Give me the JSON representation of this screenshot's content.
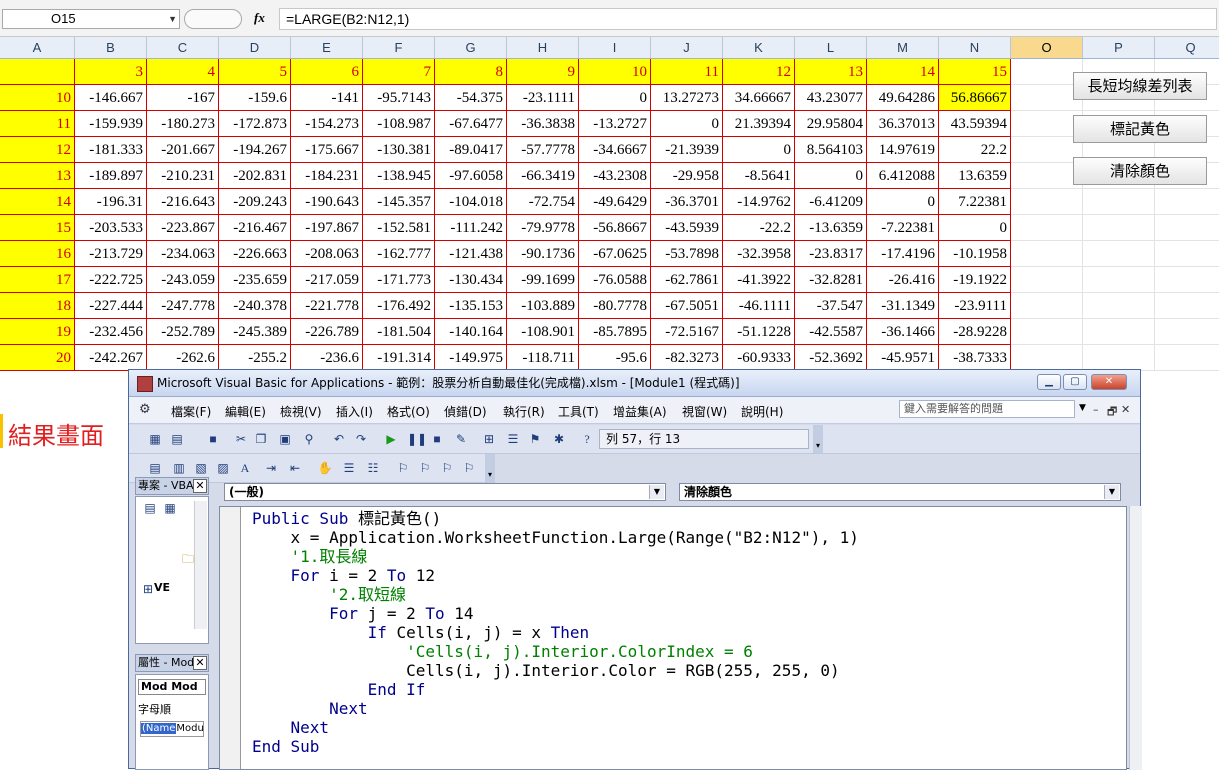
{
  "formula_bar": {
    "name_box": "O15",
    "fx_label": "fx",
    "formula": "=LARGE(B2:N12,1)"
  },
  "columns": [
    "A",
    "B",
    "C",
    "D",
    "E",
    "F",
    "G",
    "H",
    "I",
    "J",
    "K",
    "L",
    "M",
    "N",
    "O",
    "P",
    "Q"
  ],
  "selected_column": "O",
  "header_row": [
    "3",
    "4",
    "5",
    "6",
    "7",
    "8",
    "9",
    "10",
    "11",
    "12",
    "13",
    "14",
    "15"
  ],
  "rows": [
    {
      "label": "10",
      "values": [
        "-146.667",
        "-167",
        "-159.6",
        "-141",
        "-95.7143",
        "-54.375",
        "-23.1111",
        "0",
        "13.27273",
        "34.66667",
        "43.23077",
        "49.64286",
        "56.86667"
      ]
    },
    {
      "label": "11",
      "values": [
        "-159.939",
        "-180.273",
        "-172.873",
        "-154.273",
        "-108.987",
        "-67.6477",
        "-36.3838",
        "-13.2727",
        "0",
        "21.39394",
        "29.95804",
        "36.37013",
        "43.59394"
      ]
    },
    {
      "label": "12",
      "values": [
        "-181.333",
        "-201.667",
        "-194.267",
        "-175.667",
        "-130.381",
        "-89.0417",
        "-57.7778",
        "-34.6667",
        "-21.3939",
        "0",
        "8.564103",
        "14.97619",
        "22.2"
      ]
    },
    {
      "label": "13",
      "values": [
        "-189.897",
        "-210.231",
        "-202.831",
        "-184.231",
        "-138.945",
        "-97.6058",
        "-66.3419",
        "-43.2308",
        "-29.958",
        "-8.5641",
        "0",
        "6.412088",
        "13.6359"
      ]
    },
    {
      "label": "14",
      "values": [
        "-196.31",
        "-216.643",
        "-209.243",
        "-190.643",
        "-145.357",
        "-104.018",
        "-72.754",
        "-49.6429",
        "-36.3701",
        "-14.9762",
        "-6.41209",
        "0",
        "7.22381"
      ]
    },
    {
      "label": "15",
      "values": [
        "-203.533",
        "-223.867",
        "-216.467",
        "-197.867",
        "-152.581",
        "-111.242",
        "-79.9778",
        "-56.8667",
        "-43.5939",
        "-22.2",
        "-13.6359",
        "-7.22381",
        "0"
      ]
    },
    {
      "label": "16",
      "values": [
        "-213.729",
        "-234.063",
        "-226.663",
        "-208.063",
        "-162.777",
        "-121.438",
        "-90.1736",
        "-67.0625",
        "-53.7898",
        "-32.3958",
        "-23.8317",
        "-17.4196",
        "-10.1958"
      ]
    },
    {
      "label": "17",
      "values": [
        "-222.725",
        "-243.059",
        "-235.659",
        "-217.059",
        "-171.773",
        "-130.434",
        "-99.1699",
        "-76.0588",
        "-62.7861",
        "-41.3922",
        "-32.8281",
        "-26.416",
        "-19.1922"
      ]
    },
    {
      "label": "18",
      "values": [
        "-227.444",
        "-247.778",
        "-240.378",
        "-221.778",
        "-176.492",
        "-135.153",
        "-103.889",
        "-80.7778",
        "-67.5051",
        "-46.1111",
        "-37.547",
        "-31.1349",
        "-23.9111"
      ]
    },
    {
      "label": "19",
      "values": [
        "-232.456",
        "-252.789",
        "-245.389",
        "-226.789",
        "-181.504",
        "-140.164",
        "-108.901",
        "-85.7895",
        "-72.5167",
        "-51.1228",
        "-42.5587",
        "-36.1466",
        "-28.9228"
      ]
    },
    {
      "label": "20",
      "values": [
        "-242.267",
        "-262.6",
        "-255.2",
        "-236.6",
        "-191.314",
        "-149.975",
        "-118.711",
        "-95.6",
        "-82.3273",
        "-60.9333",
        "-52.3692",
        "-45.9571",
        "-38.7333"
      ]
    }
  ],
  "buttons": {
    "list": "長短均線差列表",
    "mark_yellow": "標記黃色",
    "clear_color": "清除顏色"
  },
  "result_label": "結果畫面",
  "vba": {
    "title": "Microsoft Visual Basic for Applications - 範例：股票分析自動最佳化(完成檔).xlsm - [Module1 (程式碼)]",
    "menus": [
      "檔案(F)",
      "編輯(E)",
      "檢視(V)",
      "插入(I)",
      "格式(O)",
      "偵錯(D)",
      "執行(R)",
      "工具(T)",
      "增益集(A)",
      "視窗(W)",
      "說明(H)"
    ],
    "help_placeholder": "鍵入需要解答的問題",
    "cursor_pos": "列 57，行 13",
    "project_title": "專案 - VBAI",
    "project_node": "VE",
    "props_title": "屬性 - Mod",
    "props_combo": "Mod Mod",
    "props_tab": "字母順",
    "props_name": "(Name",
    "props_value": "Modu",
    "combo_general": "(一般)",
    "combo_proc": "清除顏色",
    "code": [
      {
        "indent": "",
        "parts": [
          {
            "t": "Public Sub ",
            "c": "kw"
          },
          {
            "t": "標記黃色()",
            "c": ""
          }
        ]
      },
      {
        "indent": "    ",
        "parts": [
          {
            "t": "x = Application.WorksheetFunction.Large(Range(\"B2:N12\"), 1)",
            "c": ""
          }
        ]
      },
      {
        "indent": "    ",
        "parts": [
          {
            "t": "'1.取長線",
            "c": "cm"
          }
        ]
      },
      {
        "indent": "    ",
        "parts": [
          {
            "t": "For ",
            "c": "kw"
          },
          {
            "t": "i = 2 ",
            "c": ""
          },
          {
            "t": "To ",
            "c": "kw"
          },
          {
            "t": "12",
            "c": ""
          }
        ]
      },
      {
        "indent": "        ",
        "parts": [
          {
            "t": "'2.取短線",
            "c": "cm"
          }
        ]
      },
      {
        "indent": "        ",
        "parts": [
          {
            "t": "For ",
            "c": "kw"
          },
          {
            "t": "j = 2 ",
            "c": ""
          },
          {
            "t": "To ",
            "c": "kw"
          },
          {
            "t": "14",
            "c": ""
          }
        ]
      },
      {
        "indent": "            ",
        "parts": [
          {
            "t": "If ",
            "c": "kw"
          },
          {
            "t": "Cells(i, j) = x ",
            "c": ""
          },
          {
            "t": "Then",
            "c": "kw"
          }
        ]
      },
      {
        "indent": "                ",
        "parts": [
          {
            "t": "'Cells(i, j).Interior.ColorIndex = 6",
            "c": "cm"
          }
        ]
      },
      {
        "indent": "                ",
        "parts": [
          {
            "t": "Cells(i, j).Interior.Color = RGB(255, 255, 0)",
            "c": ""
          }
        ]
      },
      {
        "indent": "            ",
        "parts": [
          {
            "t": "End If",
            "c": "kw"
          }
        ]
      },
      {
        "indent": "        ",
        "parts": [
          {
            "t": "Next",
            "c": "kw"
          }
        ]
      },
      {
        "indent": "    ",
        "parts": [
          {
            "t": "Next",
            "c": "kw"
          }
        ]
      },
      {
        "indent": "",
        "parts": [
          {
            "t": "End Sub",
            "c": "kw"
          }
        ]
      }
    ]
  }
}
